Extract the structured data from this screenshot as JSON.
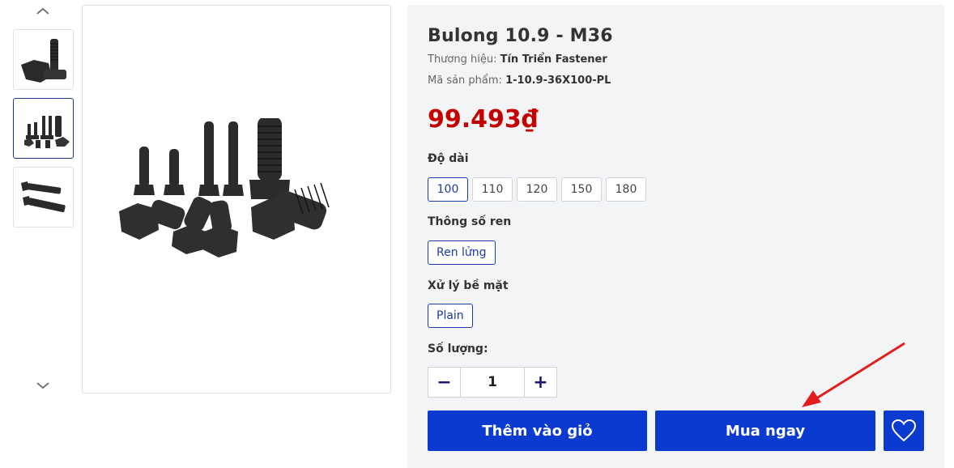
{
  "product": {
    "title": "Bulong 10.9 - M36",
    "brand_label": "Thương hiệu:",
    "brand_value": "Tín Triển Fastener",
    "sku_label": "Mã sản phẩm:",
    "sku_value": "1-10.9-36X100-PL",
    "price": "99.493₫"
  },
  "options": {
    "length": {
      "label": "Độ dài",
      "values": [
        "100",
        "110",
        "120",
        "150",
        "180"
      ],
      "selected": "100"
    },
    "thread": {
      "label": "Thông số ren",
      "values": [
        "Ren lửng"
      ],
      "selected": "Ren lửng"
    },
    "surface": {
      "label": "Xử lý bề mặt",
      "values": [
        "Plain"
      ],
      "selected": "Plain"
    }
  },
  "quantity": {
    "label": "Số lượng:",
    "value": "1",
    "minus": "−",
    "plus": "+"
  },
  "actions": {
    "add_to_cart": "Thêm vào giỏ",
    "buy_now": "Mua ngay"
  },
  "gallery": {
    "thumbnails": [
      "single-bolt-thumbnail",
      "bolt-set-thumbnail",
      "two-bolts-thumbnail"
    ],
    "active_index": 1
  },
  "colors": {
    "primary": "#0b3ad1",
    "price": "#c40000",
    "annotation_arrow": "#e11d1d"
  }
}
